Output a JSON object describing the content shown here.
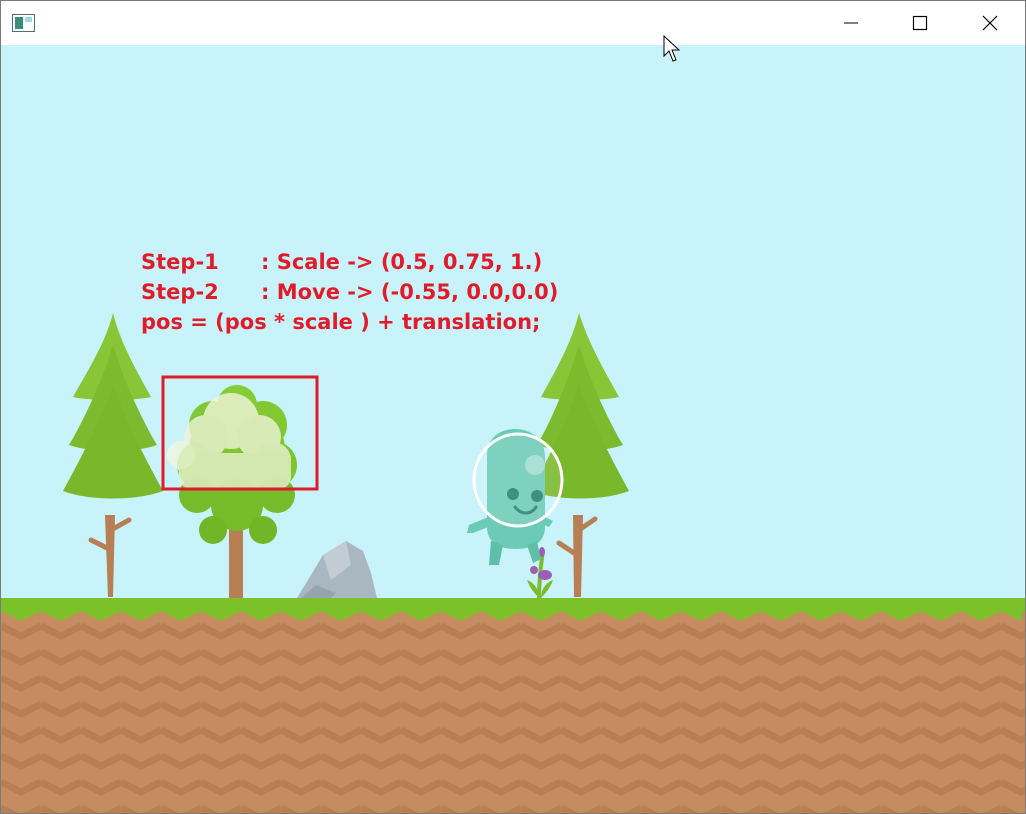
{
  "window": {
    "title": "",
    "controls": [
      "minimize-icon",
      "maximize-icon",
      "close-icon"
    ]
  },
  "overlay": {
    "step1_label": "Step-1",
    "step1_text": ": Scale -> (0.5, 0.75, 1.)",
    "step2_label": "Step-2",
    "step2_text": ": Move -> (-0.55, 0.0,0.0)",
    "formula": "pos = (pos * scale ) + translation;",
    "text_color": "#e11b2a"
  },
  "scene": {
    "sky_color": "#c8f3fb",
    "grass_color": "#7cc02a",
    "dirt_color": "#c48c60",
    "highlight_box_color": "#e11b2a",
    "objects": [
      "pine-tree-left",
      "round-tree",
      "scaled-tree-sprite",
      "rock",
      "alien-character",
      "flower",
      "pine-tree-right"
    ]
  }
}
